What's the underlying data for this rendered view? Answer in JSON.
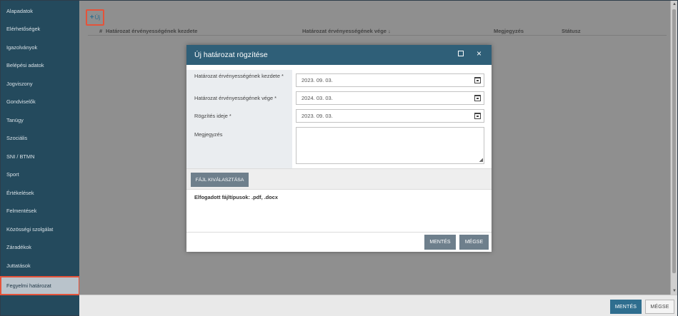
{
  "sidebar": {
    "items": [
      {
        "label": "Alapadatok"
      },
      {
        "label": "Elérhetőségek"
      },
      {
        "label": "Igazolványok"
      },
      {
        "label": "Belépési adatok"
      },
      {
        "label": "Jogviszony"
      },
      {
        "label": "Gondviselők"
      },
      {
        "label": "Tanügy"
      },
      {
        "label": "Szociális"
      },
      {
        "label": "SNI / BTMN"
      },
      {
        "label": "Sport"
      },
      {
        "label": "Értékelések"
      },
      {
        "label": "Felmentések"
      },
      {
        "label": "Közösségi szolgálat"
      },
      {
        "label": "Záradékok"
      },
      {
        "label": "Juttatások"
      },
      {
        "label": "Fegyelmi határozat",
        "active": true
      }
    ]
  },
  "toolbar": {
    "add_label": "Új"
  },
  "table": {
    "columns": {
      "hash": "#",
      "start": "Határozat érvényességének kezdete",
      "end": "Határozat érvényességének vége",
      "end_sort_icon": "↓",
      "note": "Megjegyzés",
      "status": "Státusz"
    }
  },
  "modal": {
    "title": "Új határozat rögzítése",
    "fields": {
      "start_label": "Határozat érvényességének kezdete *",
      "start_value": "2023. 09. 03.",
      "end_label": "Határozat érvényességének vége *",
      "end_value": "2024. 03. 03.",
      "recorded_label": "Rögzítés ideje *",
      "recorded_value": "2023. 09. 03.",
      "note_label": "Megjegyzés"
    },
    "upload_label": "FÁJL KIVÁLASZTÁSA",
    "accepted_types": "Elfogadott fájltípusok: .pdf, .docx",
    "save_label": "MENTÉS",
    "cancel_label": "MÉGSE"
  },
  "footer": {
    "save_label": "MENTÉS",
    "cancel_label": "MÉGSE"
  },
  "colors": {
    "sidebar_bg": "#244a5d",
    "modal_header": "#2f5f78",
    "primary_button": "#2f6e8f",
    "modal_button": "#6e7f8c",
    "highlight_outline": "#e5533a"
  },
  "icons": {
    "add": "plus-icon",
    "calendar": "calendar-icon",
    "maximize": "maximize-icon",
    "close": "close-icon",
    "sort": "sort-down-icon"
  }
}
